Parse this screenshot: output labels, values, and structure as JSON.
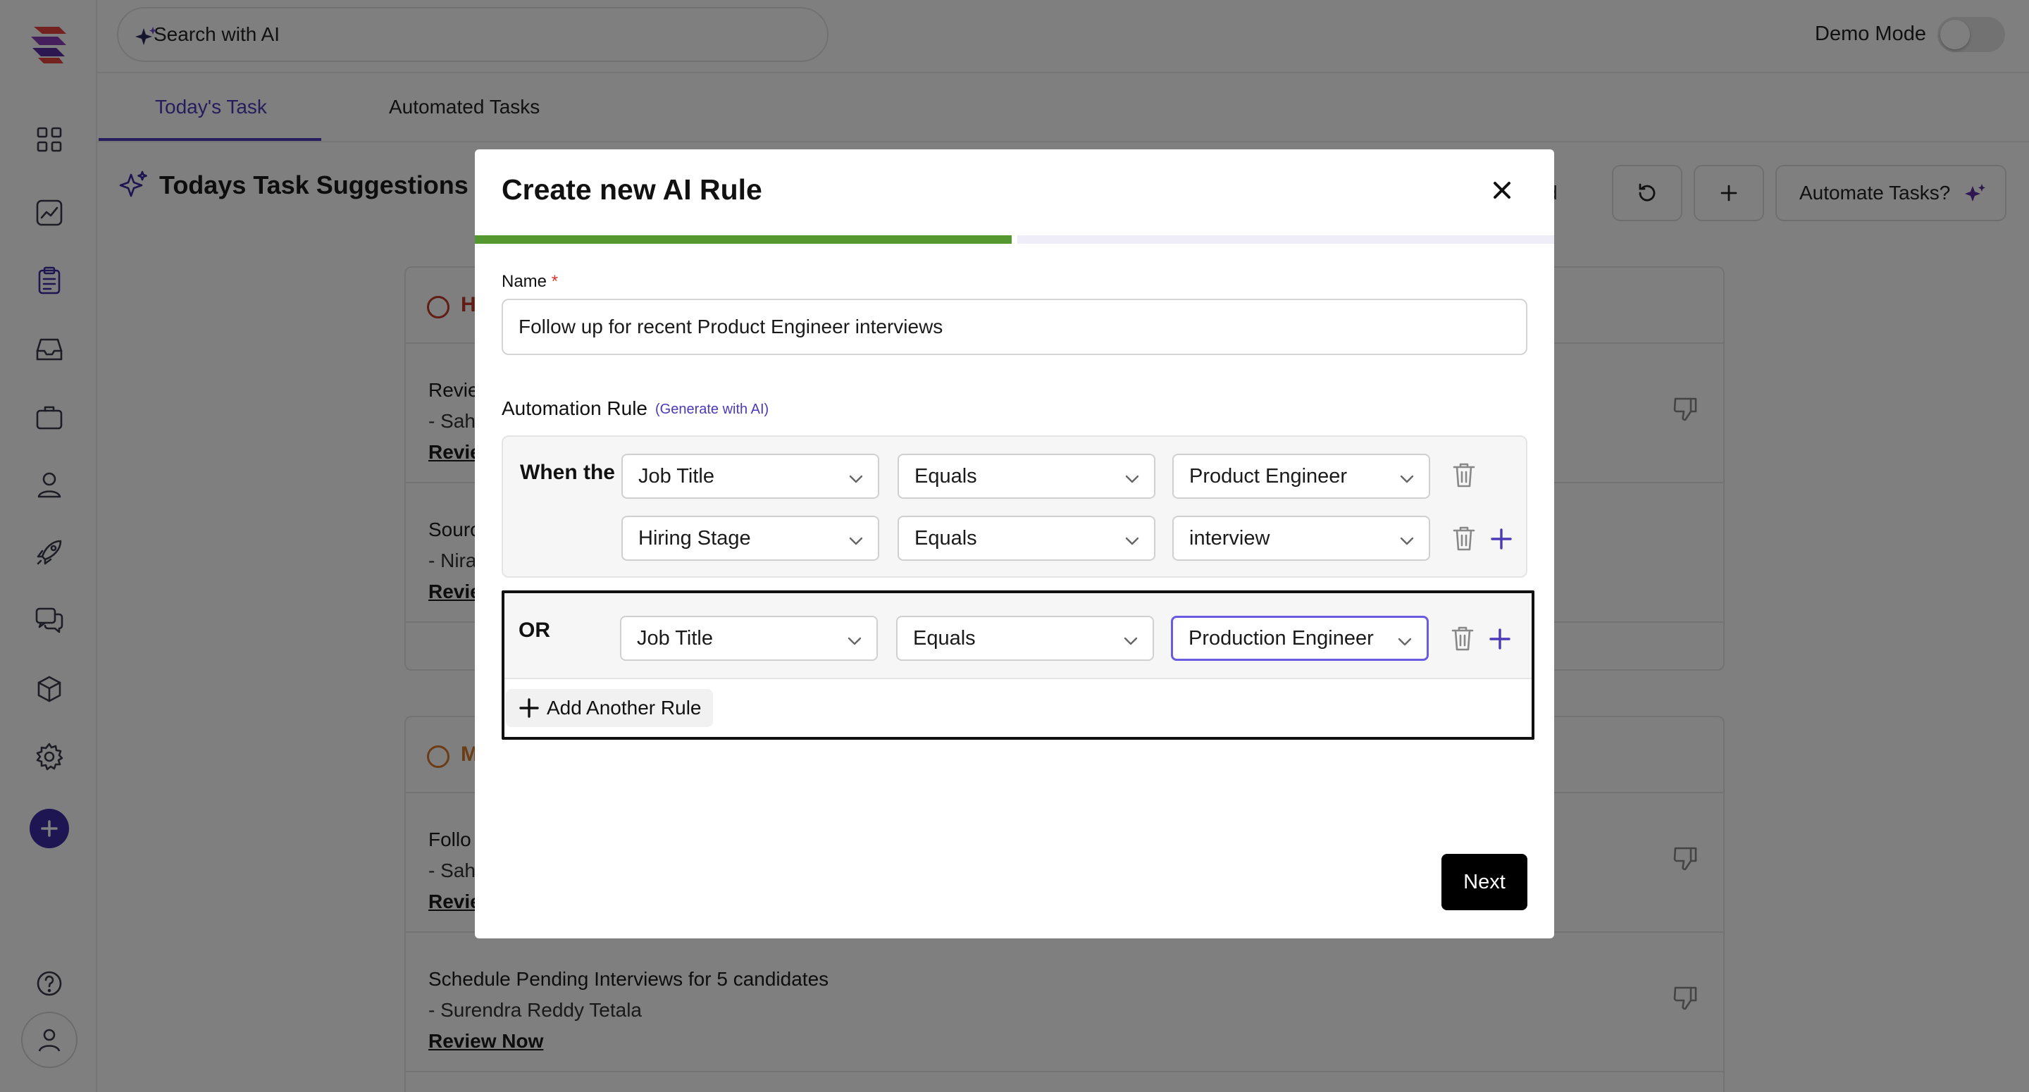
{
  "topbar": {
    "search_placeholder": "Search with AI",
    "demo_mode_label": "Demo Mode",
    "demo_mode_on": false
  },
  "tabs": [
    {
      "label": "Today's Task",
      "active": true
    },
    {
      "label": "Automated Tasks",
      "active": false
    }
  ],
  "page": {
    "title": "Todays Task Suggestions",
    "completed_partial": "leted",
    "automate_label": "Automate Tasks?"
  },
  "sidebar": {
    "icons": [
      "grid-icon",
      "chart-icon",
      "clipboard-icon",
      "inbox-icon",
      "briefcase-icon",
      "user-icon",
      "rocket-icon",
      "chat-icon",
      "cube-icon",
      "gear-icon",
      "add-icon",
      "help-icon",
      "avatar-icon"
    ]
  },
  "cards": [
    {
      "priority_partial": "H",
      "priority_color": "#c0392b",
      "tasks": [
        {
          "title": "Revie",
          "person": "- Sah",
          "action": "Revie"
        },
        {
          "title": "Sourc",
          "person": "- Nira",
          "action": "Revie"
        }
      ]
    },
    {
      "priority_partial": "M",
      "priority_color": "#d8782a",
      "tasks": [
        {
          "title": "Follo",
          "person": "- Sah",
          "action": "Revie"
        },
        {
          "title": "Schedule Pending Interviews for 5 candidates",
          "person": "- Surendra Reddy Tetala",
          "action": "Review Now"
        }
      ]
    }
  ],
  "modal": {
    "title": "Create new AI Rule",
    "step_progress_pct": 50,
    "name_label": "Name",
    "name_required_mark": "*",
    "name_value": "Follow up for recent Product Engineer interviews",
    "rule_label": "Automation Rule",
    "generate_link": "(Generate with AI)",
    "group1": {
      "label": "When the",
      "conditions": [
        {
          "field": "Job Title",
          "operator": "Equals",
          "value": "Product Engineer"
        },
        {
          "field": "Hiring Stage",
          "operator": "Equals",
          "value": "interview"
        }
      ]
    },
    "group2": {
      "label": "OR",
      "conditions": [
        {
          "field": "Job Title",
          "operator": "Equals",
          "value": "Production Engineer"
        }
      ]
    },
    "add_rule_label": "Add Another Rule",
    "next_label": "Next"
  },
  "colors": {
    "accent": "#4b3ab8",
    "progress": "#55982f",
    "overlay": "rgba(0,0,0,0.5)"
  }
}
